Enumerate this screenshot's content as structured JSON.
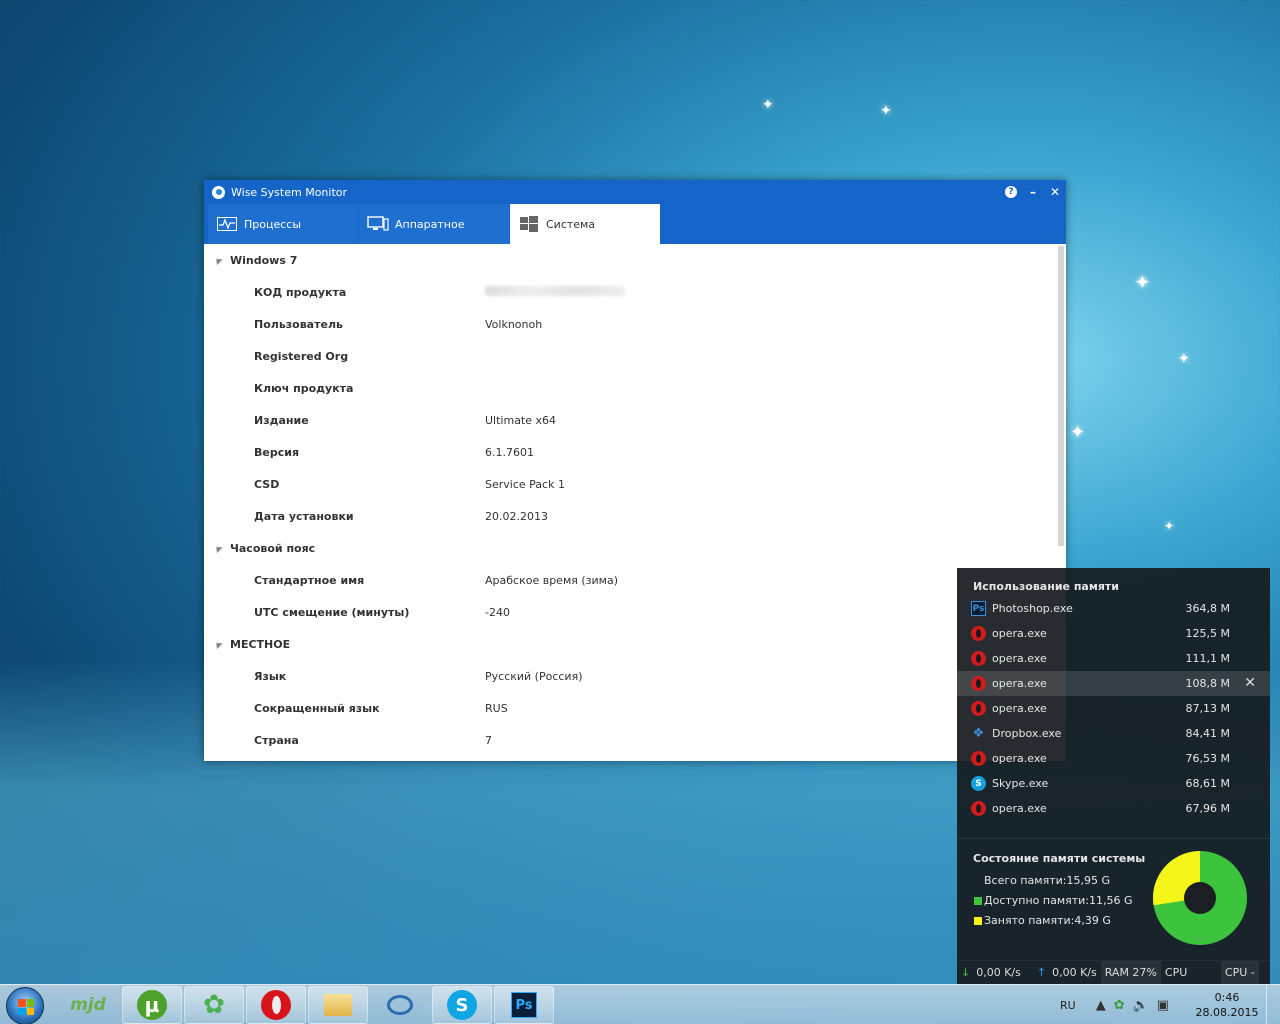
{
  "window": {
    "title": "Wise System Monitor",
    "help": "?",
    "minimize": "–",
    "close": "✕"
  },
  "tabs": [
    {
      "label": "Процессы",
      "icon": "heartbeat-icon"
    },
    {
      "label": "Аппаратное",
      "icon": "monitor-icon"
    },
    {
      "label": "Система",
      "icon": "windows-logo-icon",
      "active": true
    }
  ],
  "system": {
    "groups": [
      {
        "title": "Windows 7",
        "props": [
          {
            "name": "КОД продукта",
            "value": "",
            "blurred": true
          },
          {
            "name": "Пользователь",
            "value": "Volknonoh"
          },
          {
            "name": "Registered Org",
            "value": ""
          },
          {
            "name": "Ключ продукта",
            "value": ""
          },
          {
            "name": "Издание",
            "value": "Ultimate x64"
          },
          {
            "name": "Версия",
            "value": "6.1.7601"
          },
          {
            "name": "CSD",
            "value": "Service Pack 1"
          },
          {
            "name": "Дата установки",
            "value": "20.02.2013"
          }
        ]
      },
      {
        "title": "Часовой пояс",
        "props": [
          {
            "name": "Стандартное имя",
            "value": "Арабское время (зима)"
          },
          {
            "name": "UTC смещение (минуты)",
            "value": "-240"
          }
        ]
      },
      {
        "title": "МЕСТНОЕ",
        "props": [
          {
            "name": "Язык",
            "value": "Русский (Россия)"
          },
          {
            "name": "Сокращенный язык",
            "value": "RUS"
          },
          {
            "name": "Страна",
            "value": "7"
          }
        ]
      }
    ]
  },
  "memory_widget": {
    "title": "Использование памяти",
    "processes": [
      {
        "name": "Photoshop.exe",
        "mem": "364,8 M",
        "icon": "photoshop-icon"
      },
      {
        "name": "opera.exe",
        "mem": "125,5 M",
        "icon": "opera-icon"
      },
      {
        "name": "opera.exe",
        "mem": "111,1 M",
        "icon": "opera-icon"
      },
      {
        "name": "opera.exe",
        "mem": "108,8 M",
        "icon": "opera-icon",
        "hover": true
      },
      {
        "name": "opera.exe",
        "mem": "87,13 M",
        "icon": "opera-icon"
      },
      {
        "name": "Dropbox.exe",
        "mem": "84,41 M",
        "icon": "dropbox-icon"
      },
      {
        "name": "opera.exe",
        "mem": "76,53 M",
        "icon": "opera-icon"
      },
      {
        "name": "Skype.exe",
        "mem": "68,61 M",
        "icon": "skype-icon"
      },
      {
        "name": "opera.exe",
        "mem": "67,96 M",
        "icon": "opera-icon"
      }
    ],
    "state_title": "Состояние памяти системы",
    "total": "Всего памяти:15,95 G",
    "available": "Доступно памяти:11,56 G",
    "used": "Занято памяти:4,39 G",
    "used_fraction": 0.275,
    "colors": {
      "available": "#3cc43c",
      "used": "#f5f51a"
    },
    "bottom": {
      "down": "0,00 K/s",
      "up": "0,00 K/s",
      "ram": "RAM 27%",
      "cpu1": "CPU",
      "cpu2": "CPU -"
    }
  },
  "taskbar": {
    "apps": [
      "mjd-icon",
      "utorrent-icon",
      "icq-icon",
      "opera-icon",
      "folder-icon",
      "eye-icon",
      "skype-icon",
      "photoshop-icon"
    ],
    "mjd_label": "mjd",
    "utorrent_label": "µ",
    "icq_label": "✿",
    "skype_label": "S",
    "ps_label": "Ps",
    "lang": "RU",
    "time": "0:46",
    "date": "28.08.2015"
  }
}
